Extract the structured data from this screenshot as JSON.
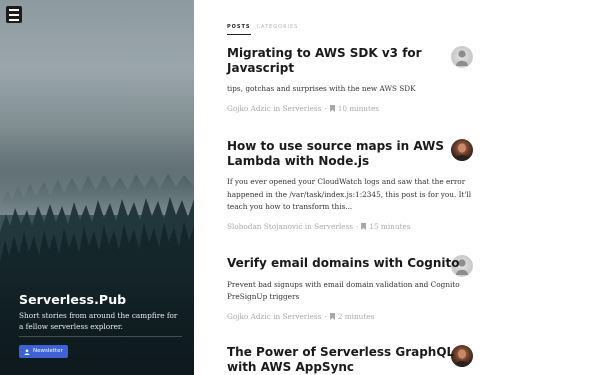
{
  "site": {
    "title": "Serverless.Pub",
    "description": "Short stories from around the campfire for a fellow serverless explorer.",
    "newsletter_label": "Newsletter",
    "menu_icon": "hamburger-menu-icon",
    "accent_color": "#3b63d6"
  },
  "tabs": [
    {
      "label": "POSTS",
      "active": true
    },
    {
      "label": "CATEGORIES",
      "active": false
    }
  ],
  "posts": [
    {
      "title": "Migrating to AWS SDK v3 for Javascript",
      "excerpt": "tips, gotchas and surprises with the new AWS SDK",
      "author": "Gojko Adzic",
      "in_label": "in",
      "category": "Serverless",
      "read_time": "10 minutes",
      "avatar": "light"
    },
    {
      "title": "How to use source maps in AWS Lambda with Node.js",
      "excerpt": "If you ever opened your CloudWatch logs and saw that the error happened in the /var/task/index.js:1:2345, this post is for you. It'll teach you how to transform this...",
      "author": "Slobodan Stojanović",
      "in_label": "in",
      "category": "Serverless",
      "read_time": "15 minutes",
      "avatar": "dark"
    },
    {
      "title": "Verify email domains with Cognito",
      "excerpt": "Prevent bad signups with email domain validation and Cognito PreSignUp triggers",
      "author": "Gojko Adzic",
      "in_label": "in",
      "category": "Serverless",
      "read_time": "2 minutes",
      "avatar": "light"
    },
    {
      "title": "The Power of Serverless GraphQL with AWS AppSync",
      "excerpt": "",
      "author": "",
      "in_label": "",
      "category": "",
      "read_time": "",
      "avatar": "dark"
    }
  ]
}
